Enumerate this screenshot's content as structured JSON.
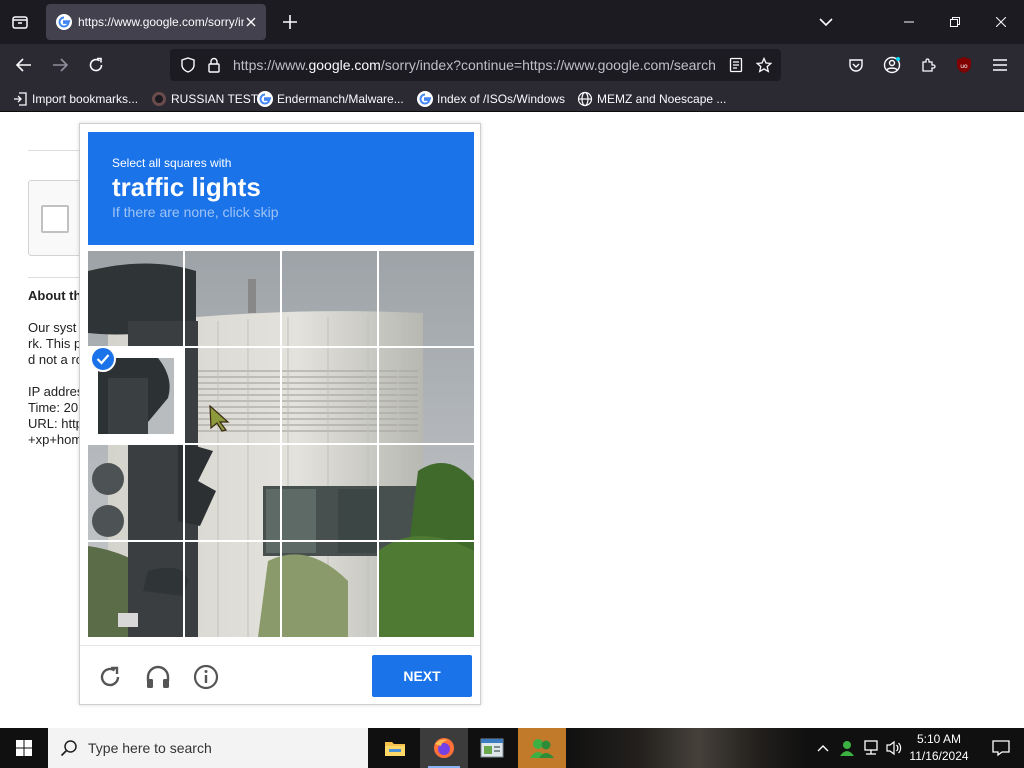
{
  "browser": {
    "tab": {
      "title": "https://www.google.com/sorry/index?continue"
    },
    "url": {
      "prefix": "https://www.",
      "domain": "google.com",
      "rest": "/sorry/index?continue=https://www.google.com/search"
    },
    "bookmarks": [
      {
        "label": "Import bookmarks...",
        "icon": "import-icon"
      },
      {
        "label": "RUSSIAN TEST",
        "icon": "russian-test-favicon"
      },
      {
        "label": "Endermanch/Malware...",
        "icon": "google-favicon"
      },
      {
        "label": "Index of /ISOs/Windows",
        "icon": "google-favicon"
      },
      {
        "label": "MEMZ and Noescape ...",
        "icon": "globe-icon"
      }
    ]
  },
  "page": {
    "about_heading": "About th",
    "para1": [
      "Our syst",
      "rk. This p",
      "d not a ro"
    ],
    "para2": [
      "IP addres",
      "Time: 20",
      "URL: http",
      "+xp+hom"
    ]
  },
  "captcha": {
    "instruction": "Select all squares with",
    "target": "traffic lights",
    "hint": "If there are none, click skip",
    "next_label": "NEXT",
    "selected_tiles": [
      5
    ],
    "accent": "#1a73e8"
  },
  "taskbar": {
    "search_placeholder": "Type here to search",
    "time": "5:10 AM",
    "date": "11/16/2024"
  }
}
